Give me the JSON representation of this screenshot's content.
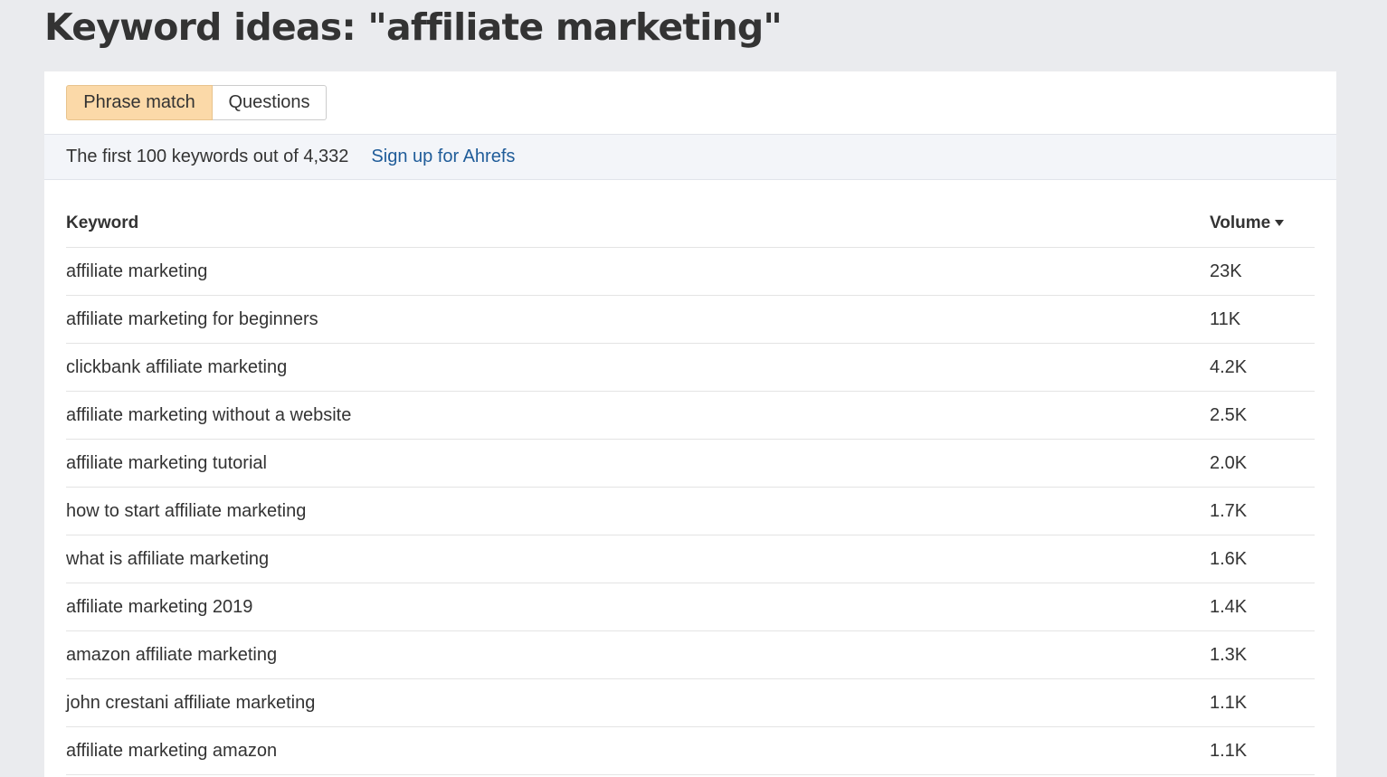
{
  "header": {
    "title": "Keyword ideas: \"affiliate marketing\""
  },
  "tabs": [
    {
      "label": "Phrase match",
      "active": true
    },
    {
      "label": "Questions",
      "active": false
    }
  ],
  "info": {
    "text": "The first 100 keywords out of 4,332",
    "link": "Sign up for Ahrefs"
  },
  "table": {
    "columns": [
      "Keyword",
      "Volume"
    ],
    "sort_icon": "caret-down-icon",
    "rows": [
      {
        "keyword": "affiliate marketing",
        "volume": "23K"
      },
      {
        "keyword": "affiliate marketing for beginners",
        "volume": "11K"
      },
      {
        "keyword": "clickbank affiliate marketing",
        "volume": "4.2K"
      },
      {
        "keyword": "affiliate marketing without a website",
        "volume": "2.5K"
      },
      {
        "keyword": "affiliate marketing tutorial",
        "volume": "2.0K"
      },
      {
        "keyword": "how to start affiliate marketing",
        "volume": "1.7K"
      },
      {
        "keyword": "what is affiliate marketing",
        "volume": "1.6K"
      },
      {
        "keyword": "affiliate marketing 2019",
        "volume": "1.4K"
      },
      {
        "keyword": "amazon affiliate marketing",
        "volume": "1.3K"
      },
      {
        "keyword": "john crestani affiliate marketing",
        "volume": "1.1K"
      },
      {
        "keyword": "affiliate marketing amazon",
        "volume": "1.1K"
      }
    ]
  },
  "colors": {
    "background": "#eaebee",
    "active_tab": "#fbd9a8",
    "link": "#1f5c99"
  }
}
